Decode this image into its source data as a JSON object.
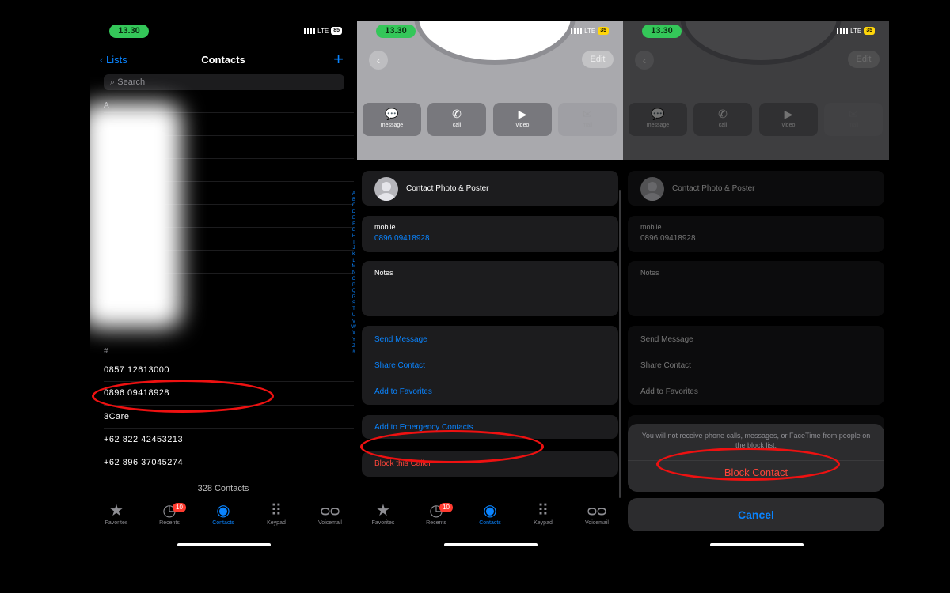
{
  "status": {
    "time": "13.30",
    "network": "LTE",
    "battery": "85",
    "battery_short": "35"
  },
  "contacts_list": {
    "back_label": "Lists",
    "title": "Contacts",
    "add_label": "+",
    "search_placeholder": "Search",
    "section_a": "A",
    "section_num": "#",
    "rows": [
      "0857 12613000",
      "0896 09418928",
      "3Care",
      "+62 822 42453213",
      "+62 896 37045274"
    ],
    "count": "328 Contacts",
    "index_letters": [
      "A",
      "B",
      "C",
      "D",
      "E",
      "F",
      "G",
      "H",
      "I",
      "J",
      "K",
      "L",
      "M",
      "N",
      "O",
      "P",
      "Q",
      "R",
      "S",
      "T",
      "U",
      "V",
      "W",
      "X",
      "Y",
      "Z",
      "#"
    ]
  },
  "tabs": [
    {
      "label": "Favorites",
      "icon": "star-icon"
    },
    {
      "label": "Recents",
      "icon": "clock-icon",
      "badge": "10"
    },
    {
      "label": "Contacts",
      "icon": "person-circle-icon"
    },
    {
      "label": "Keypad",
      "icon": "keypad-icon"
    },
    {
      "label": "Voicemail",
      "icon": "voicemail-icon"
    }
  ],
  "detail": {
    "back_glyph": "‹",
    "edit_label": "Edit",
    "actions": [
      "message",
      "call",
      "video",
      "mail"
    ],
    "photo_label": "Contact Photo & Poster",
    "mobile_label": "mobile",
    "mobile_value": "0896 09418928",
    "notes_label": "Notes",
    "send_message": "Send Message",
    "share_contact": "Share Contact",
    "add_favorites": "Add to Favorites",
    "add_emergency": "Add to Emergency Contacts",
    "block_caller": "Block this Caller"
  },
  "block_sheet": {
    "message": "You will not receive phone calls, messages, or FaceTime from people on the block list.",
    "action": "Block Contact",
    "cancel": "Cancel"
  },
  "colors": {
    "accent": "#0a84ff",
    "destructive": "#ff453a",
    "status_pill": "#34c759",
    "annotation": "#e11111"
  }
}
